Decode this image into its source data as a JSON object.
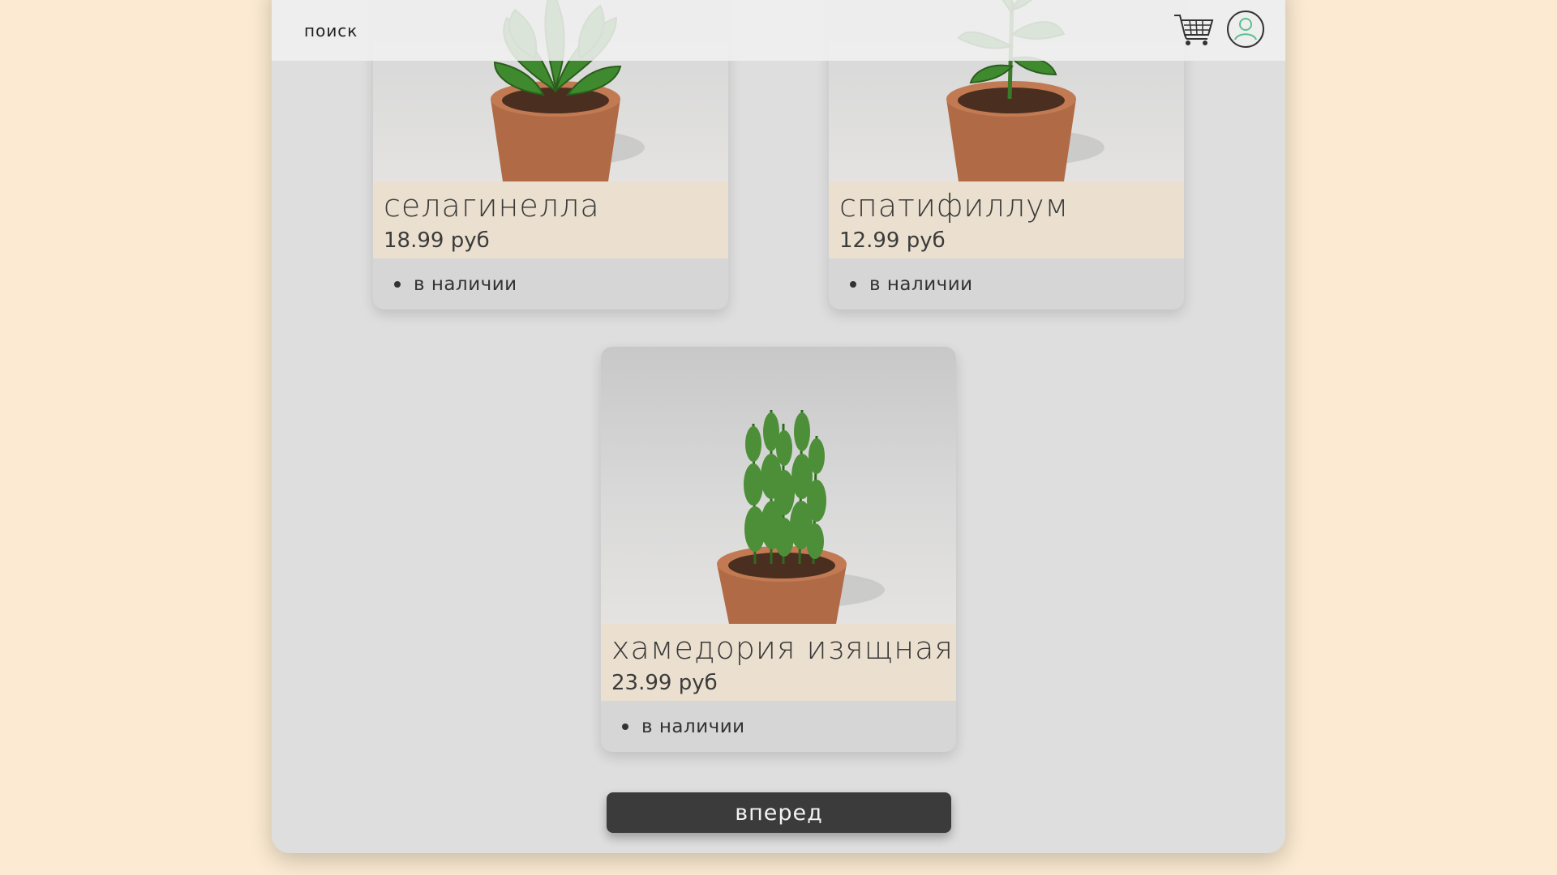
{
  "header": {
    "search_label": "поиск",
    "cart_icon": "cart-icon",
    "profile_icon": "user-profile-icon"
  },
  "products": [
    {
      "name": "селагинелла",
      "price": "18.99 руб",
      "availability": "в наличии"
    },
    {
      "name": "спатифиллум",
      "price": "12.99 руб",
      "availability": "в наличии"
    },
    {
      "name": "хамедория изящная",
      "price": "23.99 руб",
      "availability": "в наличии"
    }
  ],
  "pagination": {
    "next_label": "вперед"
  },
  "colors": {
    "background": "#fcebd2",
    "panel": "#dedede",
    "card_info": "#ebe0cf",
    "button": "#3b3b3b",
    "profile_accent": "#5bbf8f"
  }
}
